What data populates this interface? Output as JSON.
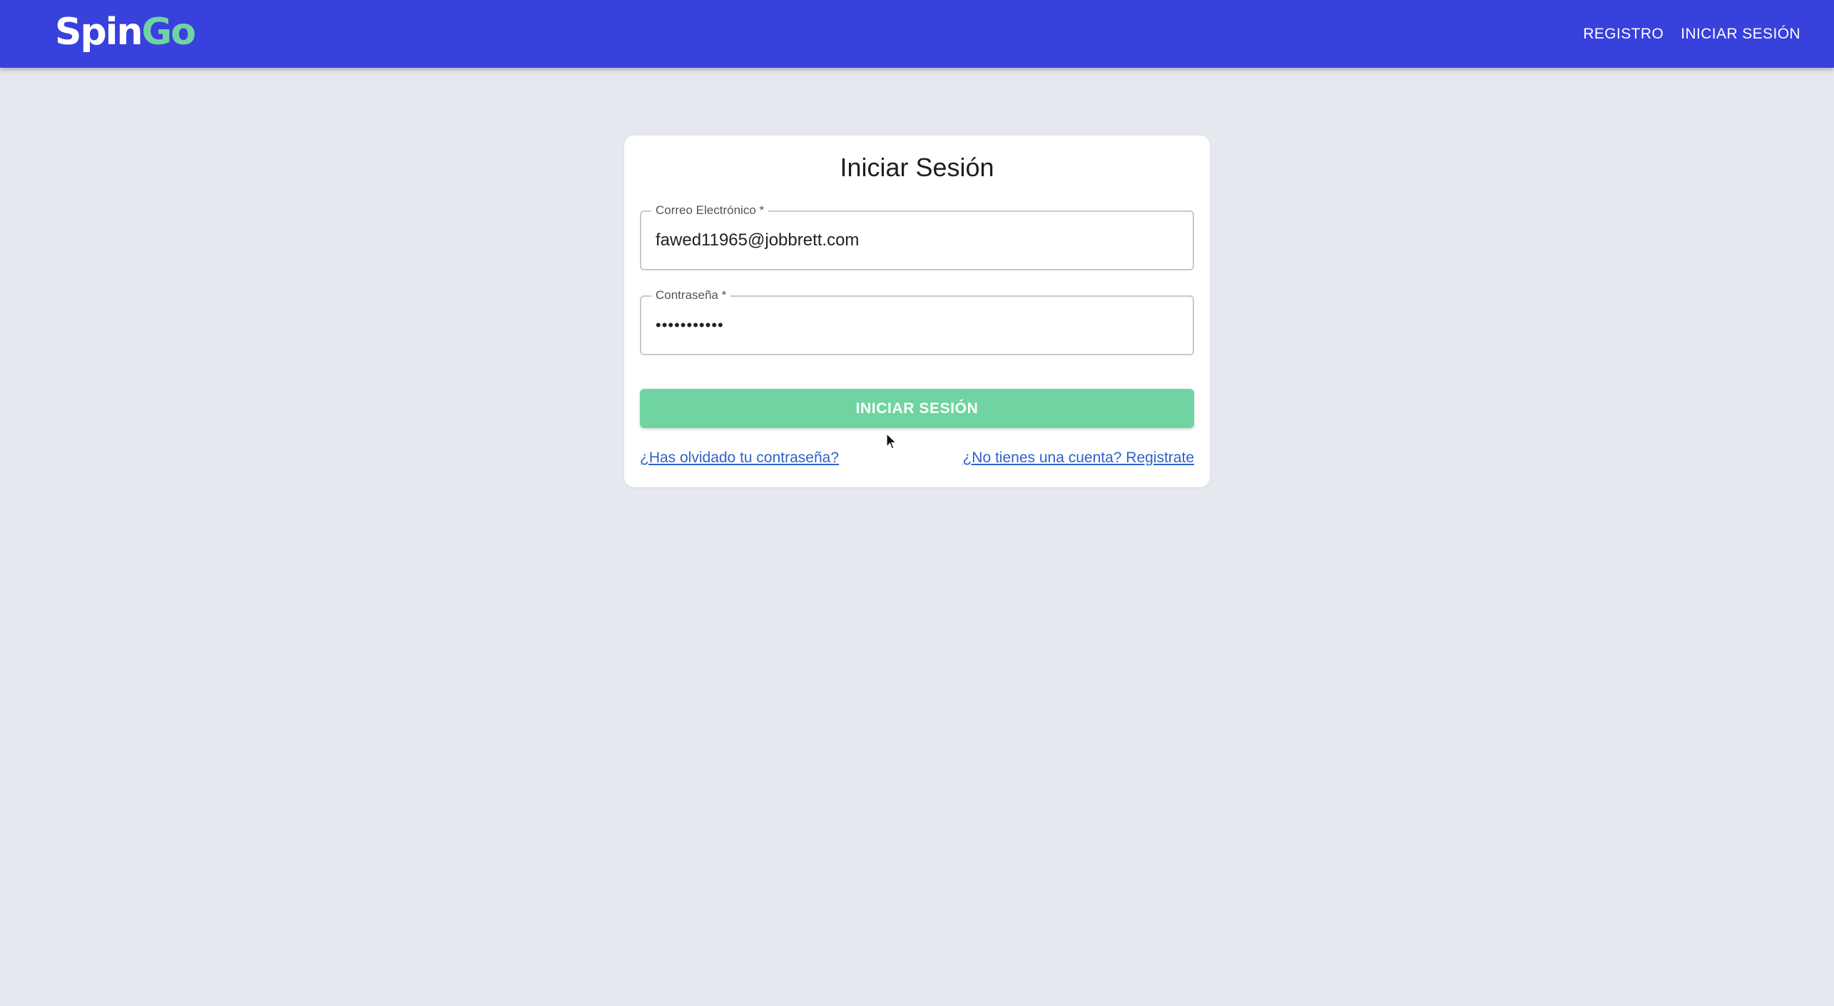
{
  "header": {
    "logo_part1": "Spin",
    "logo_part2": "Go",
    "nav": {
      "register": "REGISTRO",
      "login": "INICIAR SESIÓN"
    }
  },
  "login_form": {
    "title": "Iniciar Sesión",
    "email": {
      "label": "Correo Electrónico *",
      "value": "fawed11965@jobbrett.com"
    },
    "password": {
      "label": "Contraseña *",
      "value_masked": "•••••••••••"
    },
    "submit_label": "INICIAR SESIÓN",
    "forgot_link": "¿Has olvidado tu contraseña?",
    "register_link": "¿No tienes una cuenta? Registrate"
  },
  "colors": {
    "appbar": "#3841dc",
    "accent_green": "#6fd4a1",
    "background": "#e6e8ef",
    "link": "#2f62c8"
  },
  "icons": {
    "cursor": "mouse-pointer-icon"
  }
}
